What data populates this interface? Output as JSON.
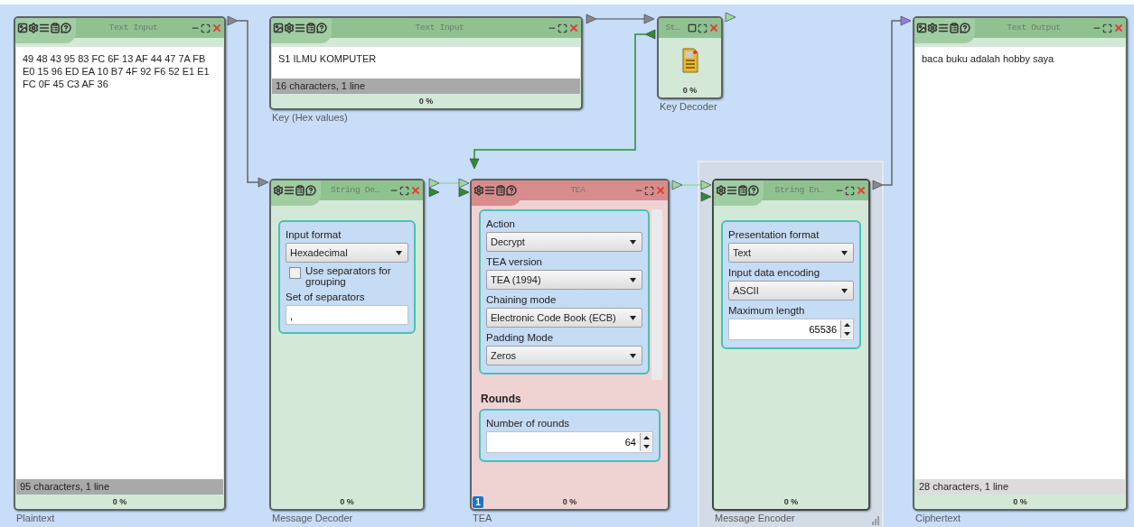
{
  "nodes": [
    {
      "kind": "text_input",
      "title": "Text Input",
      "caption": "Plaintext",
      "selected": false,
      "color": "#8fc290",
      "text": "49 48 43 95 83 FC 6F 13 AF 44 47 7A FB E0 15 96 ED EA 10 B7 4F 92 F6 52 E1 E1 FC 0F 45 C3 AF 36",
      "status": "95 characters,  1 line",
      "progress": "0 %"
    },
    {
      "kind": "text_input",
      "title": "Text Input",
      "caption": "Key (Hex values)",
      "selected": false,
      "color": "#8fc290",
      "text": "S1 ILMU KOMPUTER",
      "status": "16 characters,  1 line",
      "progress": "0 %"
    },
    {
      "kind": "settings",
      "title": "String De…",
      "caption": "Message Decoder",
      "selected": false,
      "color": "#8fc290",
      "progress": "0 %",
      "groups": [
        {
          "fields": [
            {
              "kind": "select",
              "label": "Input format",
              "value": "Hexadecimal"
            },
            {
              "kind": "checkbox",
              "label": "Use separators for grouping",
              "checked": false
            },
            {
              "kind": "text",
              "label": "Set of separators",
              "value": ","
            }
          ]
        }
      ]
    },
    {
      "kind": "settings",
      "title": "TEA",
      "caption": "TEA",
      "selected": false,
      "color": "#d98c8c",
      "progress": "0 %",
      "badge": "1",
      "groups": [
        {
          "fields": [
            {
              "kind": "select",
              "label": "Action",
              "value": "Decrypt"
            },
            {
              "kind": "select",
              "label": "TEA version",
              "value": "TEA (1994)"
            },
            {
              "kind": "select",
              "label": "Chaining mode",
              "value": "Electronic Code Book (ECB)"
            },
            {
              "kind": "select",
              "label": "Padding Mode",
              "value": "Zeros"
            }
          ]
        },
        {
          "title": "Rounds",
          "fields": [
            {
              "kind": "number",
              "label": "Number of rounds",
              "value": "64"
            }
          ]
        }
      ]
    },
    {
      "kind": "icon",
      "title": "St…",
      "caption": "Key Decoder",
      "selected": false,
      "color": "#8fc290",
      "progress": "0 %"
    },
    {
      "kind": "settings",
      "title": "String En…",
      "caption": "Message Encoder",
      "selected": true,
      "color": "#8fc290",
      "progress": "0 %",
      "groups": [
        {
          "fields": [
            {
              "kind": "select",
              "label": "Presentation format",
              "value": "Text"
            },
            {
              "kind": "select",
              "label": "Input data encoding",
              "value": "ASCII"
            },
            {
              "kind": "number",
              "label": "Maximum length",
              "value": "65536"
            }
          ]
        }
      ]
    },
    {
      "kind": "text_output",
      "title": "Text Output",
      "caption": "Ciphertext",
      "selected": false,
      "color": "#8fc290",
      "text": "baca buku adalah hobby saya",
      "status": "28 characters,  1 line",
      "progress": "0 %"
    }
  ]
}
